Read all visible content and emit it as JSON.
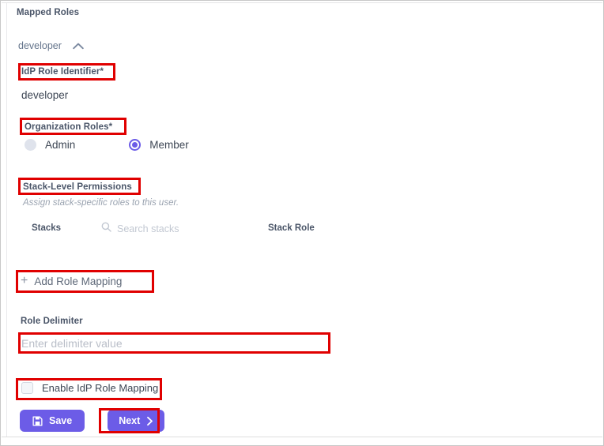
{
  "page": {
    "title": "Mapped Roles"
  },
  "colors": {
    "accent": "#6c5ce7",
    "annotation": "#e00000",
    "label_text": "#4a5568",
    "value_text": "#3d4654",
    "muted_text": "#9aa3b0",
    "placeholder": "#b9bec8"
  },
  "role_group": {
    "name": "developer",
    "collapse_icon": "chevron-up-icon",
    "expanded": true
  },
  "idp_role_identifier": {
    "label": "IdP Role Identifier*",
    "value": "developer"
  },
  "organization_roles": {
    "label": "Organization Roles*",
    "options": [
      {
        "label": "Admin",
        "selected": false
      },
      {
        "label": "Member",
        "selected": true
      }
    ]
  },
  "stack_level_permissions": {
    "label": "Stack-Level Permissions",
    "helper": "Assign stack-specific roles to this user.",
    "table": {
      "columns": [
        "Stacks",
        "Stack Role"
      ],
      "search": {
        "icon": "search-icon",
        "placeholder": "Search stacks",
        "value": ""
      },
      "rows": []
    }
  },
  "add_role_mapping": {
    "icon": "plus-icon",
    "label": "Add Role Mapping"
  },
  "role_delimiter": {
    "label": "Role Delimiter",
    "placeholder": "Enter delimiter value",
    "value": ""
  },
  "enable_idp_role_mapping": {
    "label": "Enable IdP Role Mapping",
    "checked": false
  },
  "actions": {
    "save": {
      "label": "Save",
      "icon": "save-disk-icon"
    },
    "next": {
      "label": "Next",
      "icon": "chevron-right-icon"
    }
  }
}
